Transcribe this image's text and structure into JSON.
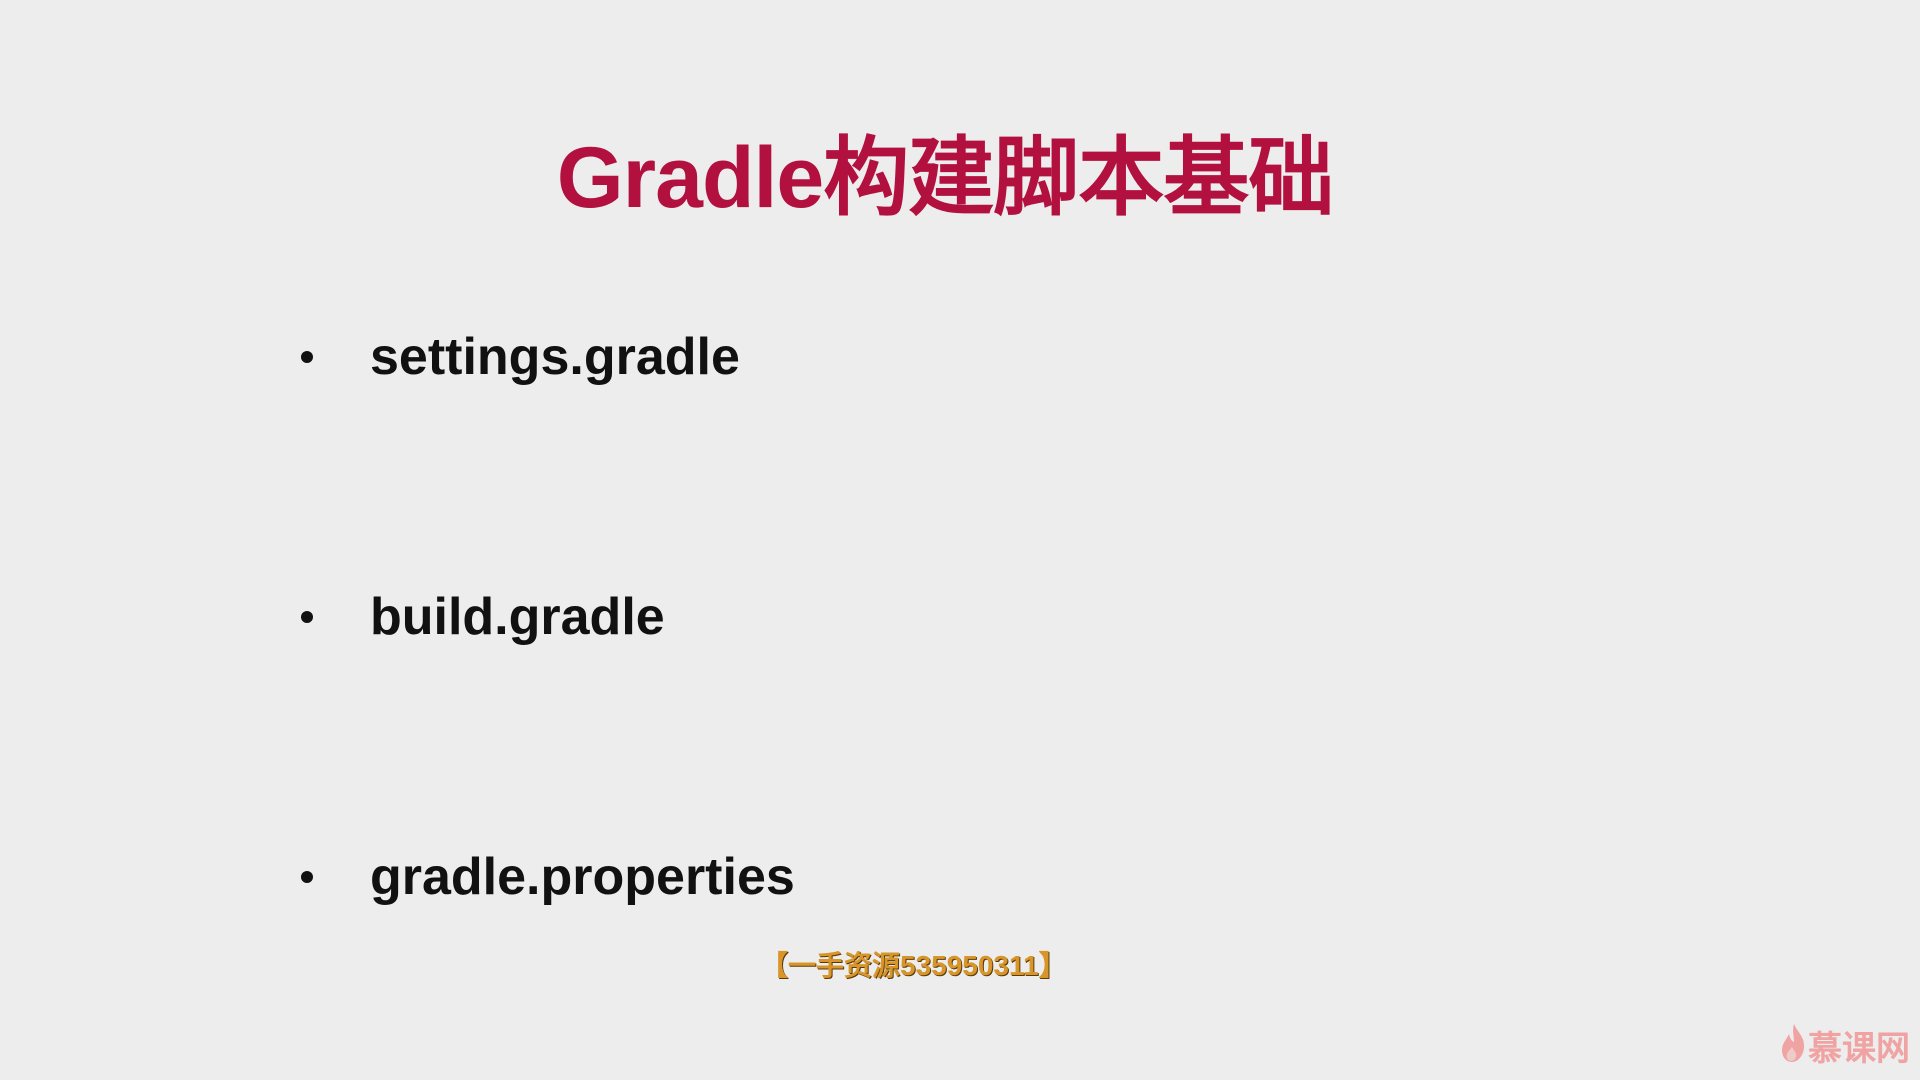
{
  "slide": {
    "title": "Gradle构建脚本基础",
    "bullets": [
      "settings.gradle",
      "build.gradle",
      "gradle.properties"
    ],
    "watermark": "【一手资源535950311】",
    "logo_text": "慕课网"
  },
  "colors": {
    "background": "#ededed",
    "title": "#b2113f",
    "bullet_text": "#111111",
    "watermark": "#d8962a",
    "logo": "#f0a3a3"
  },
  "icons": {
    "logo": "flame-icon"
  }
}
